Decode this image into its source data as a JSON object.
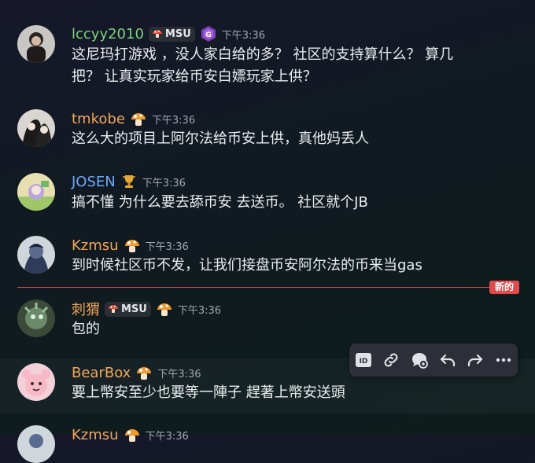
{
  "messages": [
    {
      "username": "lccyy2010",
      "name_color": "#7cd37c",
      "tag": "MSU",
      "time": "下午3:36",
      "lines": [
        "这尼玛打游戏 ，没人家白给的多？ 社区的支持算什么？ 算几",
        "把？ 让真实玩家给币安白嫖玩家上供？"
      ]
    },
    {
      "username": "tmkobe",
      "name_color": "#f2a65a",
      "time": "下午3:36",
      "lines": [
        "这么大的项目上阿尔法给币安上供，真他妈丢人"
      ]
    },
    {
      "username": "JOSEN",
      "name_color": "#6fa8f5",
      "time": "下午3:36",
      "lines": [
        "搞不懂 为什么要去舔币安 去送币。 社区就个JB"
      ]
    },
    {
      "username": "Kzmsu",
      "name_color": "#f2a65a",
      "time": "下午3:36",
      "lines": [
        "到时候社区币不发，让我们接盘币安阿尔法的币来当gas"
      ]
    },
    {
      "username": "刺猬",
      "name_color": "#f2a65a",
      "tag": "MSU",
      "time": "下午3:36",
      "lines": [
        "包的"
      ]
    },
    {
      "username": "BearBox",
      "name_color": "#f2a65a",
      "time": "下午3:36",
      "lines": [
        "要上幣安至少也要等一陣子 趕著上幣安送頭"
      ]
    },
    {
      "username": "Kzmsu",
      "name_color": "#f2a65a",
      "time": "下午3:36",
      "lines": []
    }
  ],
  "new_divider": "新的",
  "toolbar": {
    "icons": [
      "id-icon",
      "link-icon",
      "thread-icon",
      "reply-icon",
      "forward-icon",
      "more-icon"
    ]
  },
  "colors": {
    "mention_red": "#e14a4a",
    "tag_bg": "#2a2f36"
  }
}
